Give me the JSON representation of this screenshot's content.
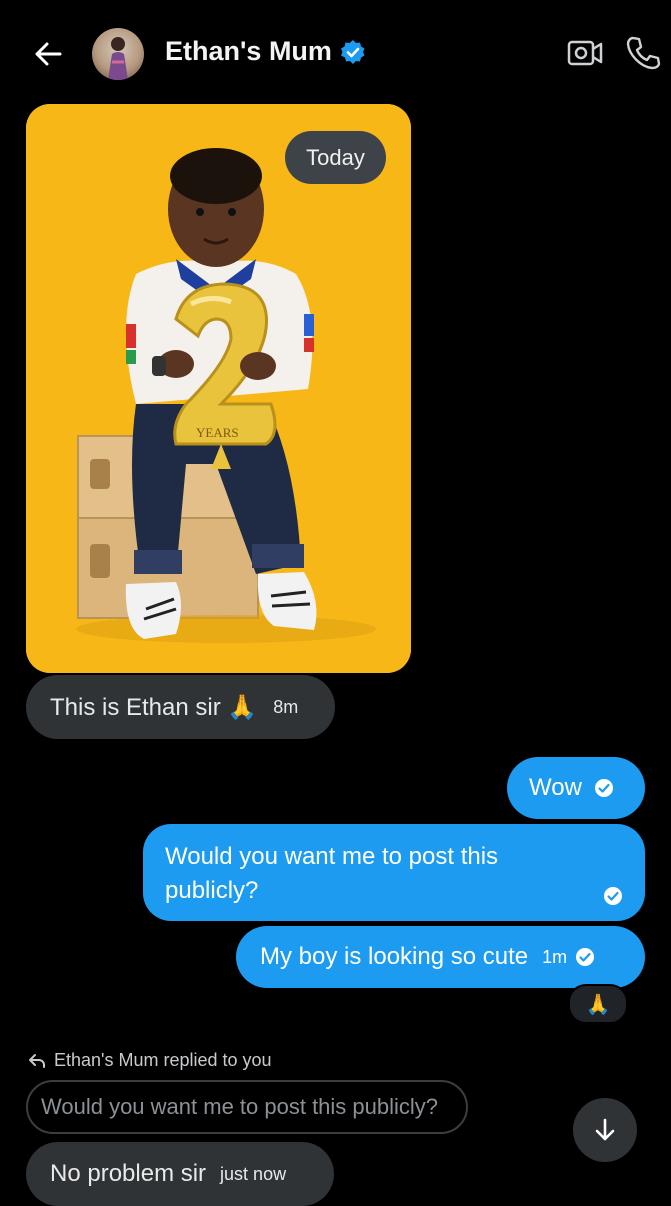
{
  "header": {
    "title": "Ethan's Mum",
    "back_icon": "back-arrow-icon",
    "verified_icon": "verified-badge-icon",
    "video_icon": "video-call-icon",
    "phone_icon": "phone-call-icon"
  },
  "conversation": {
    "date_chip": "Today",
    "messages": [
      {
        "direction": "incoming",
        "text": "This is Ethan sir 🙏",
        "time": "8m"
      },
      {
        "direction": "outgoing",
        "text": "Wow",
        "time": ""
      },
      {
        "direction": "outgoing",
        "text": "Would you want me to post this publicly?",
        "time": ""
      },
      {
        "direction": "outgoing",
        "text": "My boy is looking so cute",
        "time": "1m"
      },
      {
        "direction": "incoming",
        "text": "No problem sir",
        "time": "just now"
      }
    ],
    "reaction": "🙏",
    "reply_label": "Ethan's Mum replied to you",
    "reply_quote": "Would you want me to post this publicly?"
  },
  "colors": {
    "background": "#000000",
    "outgoing_bubble": "#1d9bf0",
    "incoming_bubble": "#2f3336",
    "photo_background": "#f7b817"
  }
}
